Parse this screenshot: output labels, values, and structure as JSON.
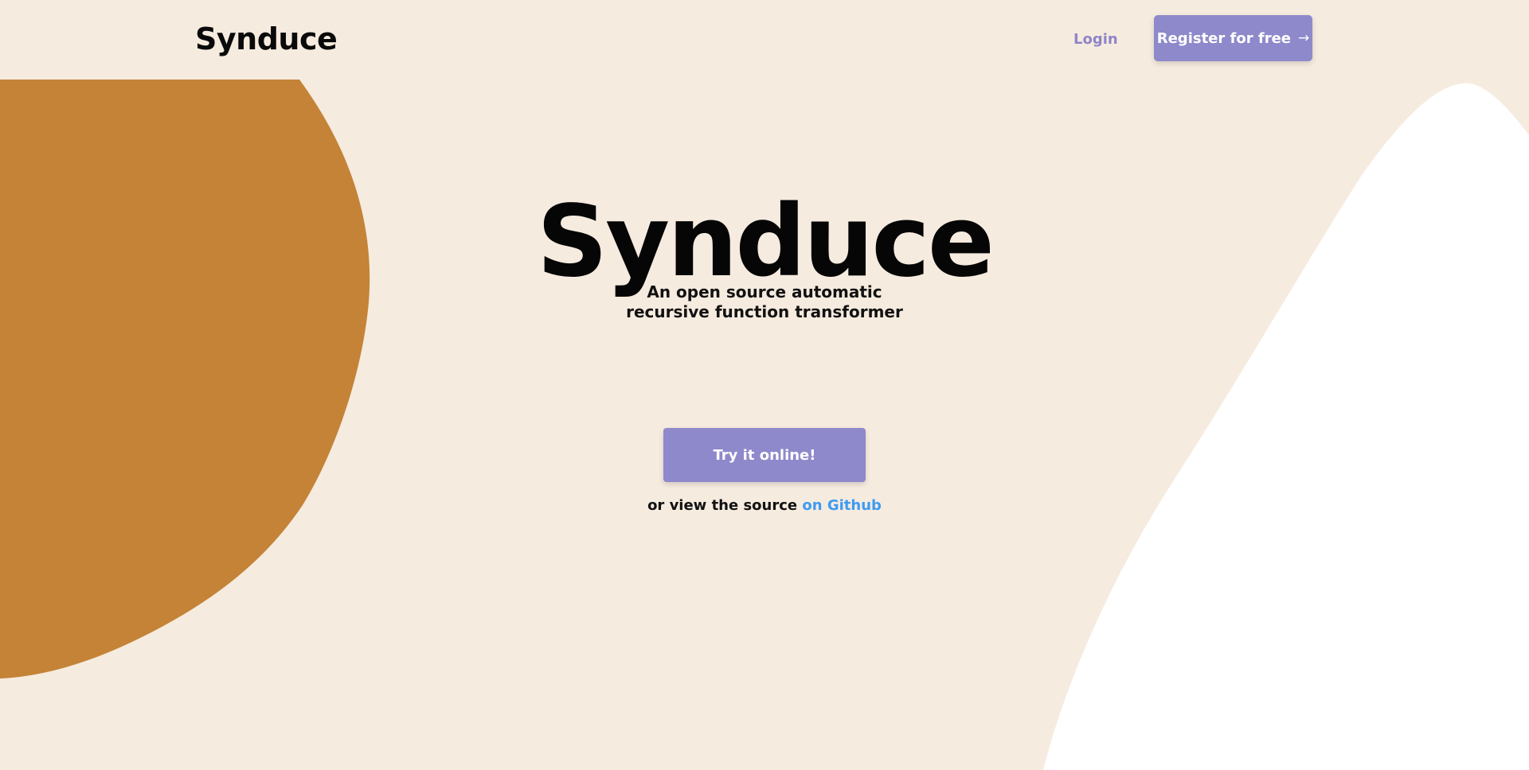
{
  "header": {
    "brand": "Synduce",
    "login_label": "Login",
    "register_label": "Register for free",
    "register_icon": "arrow-right-icon"
  },
  "hero": {
    "title": "Synduce",
    "subtitle_line1": "An open source automatic",
    "subtitle_line2": "recursive function transformer",
    "cta_label": "Try it online!",
    "source_prefix": "or view the source",
    "source_link_label": "on Github"
  },
  "colors": {
    "background": "#f6ebdf",
    "accent_purple": "#8e89cb",
    "orange_blob": "#c48337",
    "white_blob": "#ffffff",
    "link_blue": "#3d9bf2"
  }
}
